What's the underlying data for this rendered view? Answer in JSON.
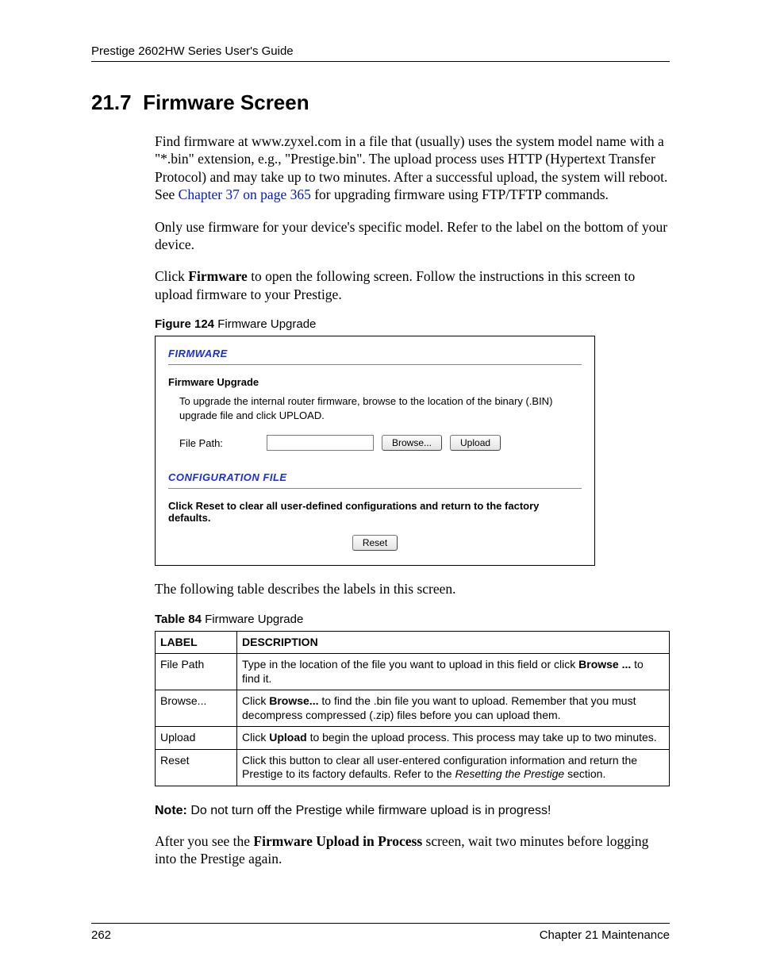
{
  "header": {
    "title": "Prestige 2602HW Series User's Guide"
  },
  "section": {
    "number": "21.7",
    "title": "Firmware Screen"
  },
  "paragraphs": {
    "p1a": "Find firmware at www.zyxel.com in a file that (usually) uses the system model name with a \"*.bin\" extension, e.g., \"Prestige.bin\". The upload process uses HTTP (Hypertext Transfer Protocol) and may take up to two minutes. After a successful upload, the system will reboot. See ",
    "p1_link": "Chapter 37 on page 365",
    "p1b": " for upgrading firmware using FTP/TFTP commands.",
    "p2": "Only use firmware for your device's specific model. Refer to the label on the bottom of your device.",
    "p3a": "Click ",
    "p3b": "Firmware",
    "p3c": " to open the following screen. Follow the instructions in this screen to upload firmware to your Prestige.",
    "after_figure": "The following table describes the labels in this screen.",
    "note_label": "Note:",
    "note_text": " Do not turn off the Prestige while firmware upload is in progress!",
    "closing_a": "After you see the ",
    "closing_b": "Firmware Upload in Process",
    "closing_c": " screen, wait two minutes before logging into the Prestige again."
  },
  "figure": {
    "caption_bold": "Figure 124",
    "caption_rest": "   Firmware Upgrade",
    "section1_title": "FIRMWARE",
    "subtitle": "Firmware Upgrade",
    "instruction": "To upgrade the internal router firmware, browse to the location of the binary (.BIN) upgrade file and click UPLOAD.",
    "file_label": "File Path:",
    "browse_label": "Browse...",
    "upload_label": "Upload",
    "section2_title": "CONFIGURATION FILE",
    "reset_text": "Click Reset to clear all user-defined configurations and return to the factory defaults.",
    "reset_label": "Reset"
  },
  "table": {
    "caption_bold": "Table 84",
    "caption_rest": "   Firmware Upgrade",
    "headers": {
      "label": "LABEL",
      "description": "DESCRIPTION"
    },
    "rows": [
      {
        "label": "File Path",
        "desc_a": "Type in the location of the file you want to upload in this field or click ",
        "desc_bold": "Browse ...",
        "desc_b": " to find it."
      },
      {
        "label": "Browse...",
        "desc_a": "Click ",
        "desc_bold": "Browse...",
        "desc_b": " to find the .bin file you want to upload. Remember that you must decompress compressed (.zip) files before you can upload them."
      },
      {
        "label": "Upload",
        "desc_a": "Click ",
        "desc_bold": "Upload",
        "desc_b": " to begin the upload process. This process may take up to two minutes."
      },
      {
        "label": "Reset",
        "desc_a": "Click this button to clear all user-entered configuration information and return the Prestige to its factory defaults. Refer to the ",
        "desc_italic": "Resetting the Prestige",
        "desc_b": " section."
      }
    ]
  },
  "footer": {
    "page": "262",
    "chapter": "Chapter 21 Maintenance"
  }
}
